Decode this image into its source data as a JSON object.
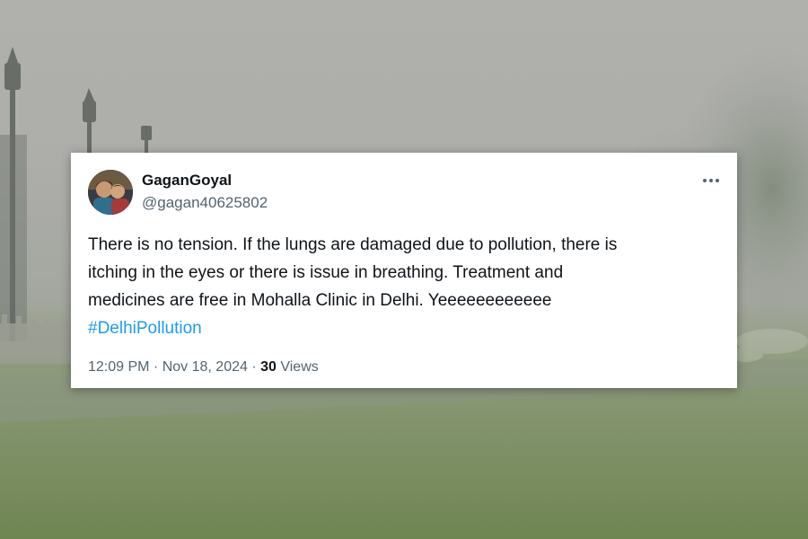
{
  "tweet": {
    "display_name": "GaganGoyal",
    "handle": "@gagan40625802",
    "text_line_1": "There is no tension. If the lungs are damaged due to pollution, there is",
    "text_line_2": "itching in the eyes or there is issue in breathing. Treatment and",
    "text_line_3": "medicines are free in Mohalla Clinic in Delhi. Yeeeeeeeeeeee",
    "hashtag": "#DelhiPollution",
    "time": "12:09 PM",
    "separator": " · ",
    "date": "Nov 18, 2024",
    "views_count": "30",
    "views_label": "Views",
    "more_icon": "more-horizontal-icon"
  },
  "colors": {
    "hashtag": "#1d9bf0",
    "text": "#0f1419",
    "secondary_text": "#536471",
    "card_background": "#ffffff"
  }
}
